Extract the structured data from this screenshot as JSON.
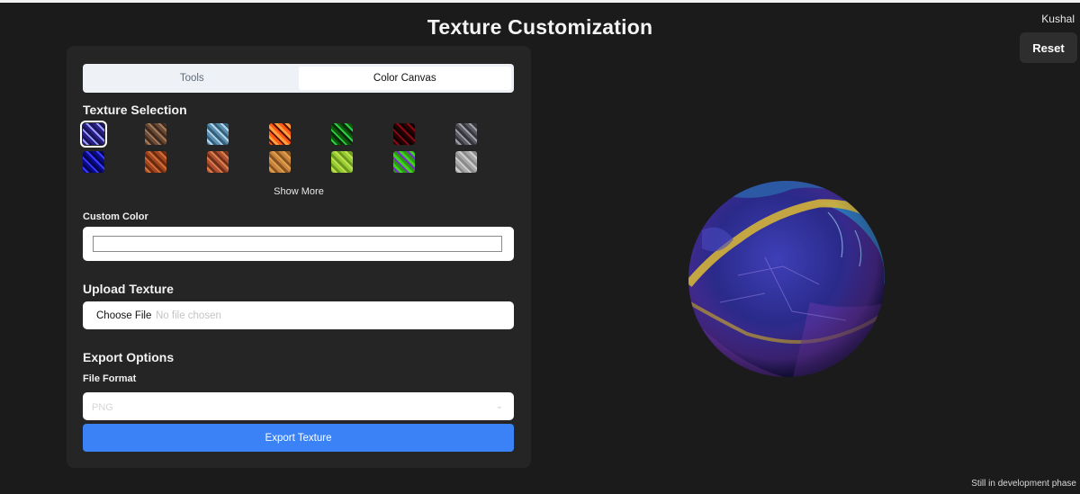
{
  "header": {
    "title": "Texture Customization",
    "user_name": "Kushal",
    "reset_label": "Reset"
  },
  "tabs": [
    {
      "label": "Tools",
      "active": false
    },
    {
      "label": "Color Canvas",
      "active": true
    }
  ],
  "texture_selection": {
    "title": "Texture Selection",
    "textures": [
      {
        "name": "purple-cracked",
        "colors": [
          "#2a1f8a",
          "#9aa0ff",
          "#1a1456"
        ],
        "selected": true
      },
      {
        "name": "brown-stone",
        "colors": [
          "#6b4a35",
          "#a37a5a",
          "#3e2a1f"
        ],
        "selected": false
      },
      {
        "name": "blue-ice",
        "colors": [
          "#5b8fb0",
          "#b4d6ea",
          "#35607a"
        ],
        "selected": false
      },
      {
        "name": "lava",
        "colors": [
          "#ff5a14",
          "#5a1408",
          "#ffa03c"
        ],
        "selected": false
      },
      {
        "name": "green-circuit",
        "colors": [
          "#0b2a0b",
          "#2ecc40",
          "#0d5a0d"
        ],
        "selected": false
      },
      {
        "name": "dark-red",
        "colors": [
          "#2a0205",
          "#8a0a14",
          "#120102"
        ],
        "selected": false
      },
      {
        "name": "grey-cobble",
        "colors": [
          "#5a5a62",
          "#a0a0a8",
          "#35353c"
        ],
        "selected": false
      },
      {
        "name": "blue-crystal",
        "colors": [
          "#0a0a8a",
          "#3a3aff",
          "#050550"
        ],
        "selected": false
      },
      {
        "name": "orange-brick",
        "colors": [
          "#a3461f",
          "#d07038",
          "#6a2a10"
        ],
        "selected": false
      },
      {
        "name": "red-brick",
        "colors": [
          "#b05030",
          "#d88050",
          "#70301a"
        ],
        "selected": false
      },
      {
        "name": "wood-plank",
        "colors": [
          "#c8843c",
          "#e0a050",
          "#8a5420"
        ],
        "selected": false
      },
      {
        "name": "moss",
        "colors": [
          "#9acd32",
          "#c0e050",
          "#6a9a20"
        ],
        "selected": false
      },
      {
        "name": "green-purple",
        "colors": [
          "#2a9a10",
          "#7a2ad0",
          "#40d020"
        ],
        "selected": false
      },
      {
        "name": "grey-plaster",
        "colors": [
          "#a8a8a8",
          "#cfcfcf",
          "#8a8a8a"
        ],
        "selected": false
      }
    ],
    "show_more_label": "Show More"
  },
  "custom_color": {
    "label": "Custom Color",
    "value": ""
  },
  "upload": {
    "title": "Upload Texture",
    "button_label": "Choose File",
    "status": "No file chosen"
  },
  "export": {
    "title": "Export Options",
    "format_label": "File Format",
    "format_value": "PNG",
    "button_label": "Export Texture"
  },
  "preview": {
    "object": "sphere",
    "texture": "purple-cracked"
  },
  "footer": {
    "note": "Still in development phase"
  }
}
